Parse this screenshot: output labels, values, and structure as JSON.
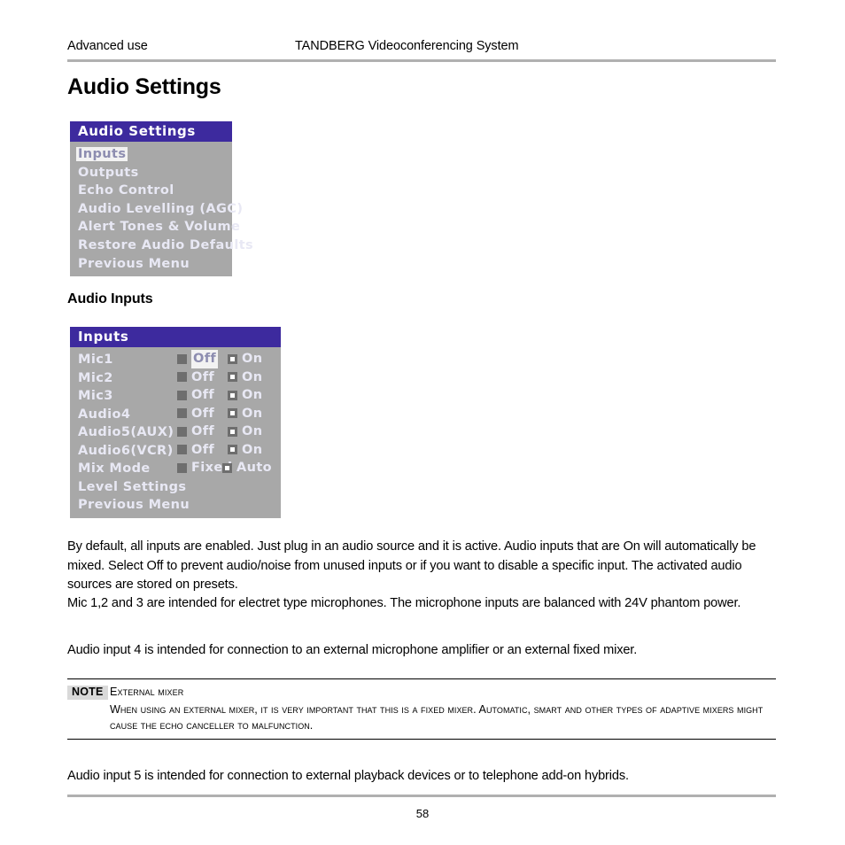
{
  "header": {
    "left": "Advanced use",
    "center": "TANDBERG Videoconferencing System"
  },
  "page_title": "Audio Settings",
  "sub_title": "Audio Inputs",
  "menu_audio_settings": {
    "title": "Audio Settings",
    "items": [
      {
        "label": "Inputs",
        "highlighted": true
      },
      {
        "label": "Outputs",
        "highlighted": false
      },
      {
        "label": "Echo Control",
        "highlighted": false
      },
      {
        "label": "Audio Levelling (AGC)",
        "highlighted": false
      },
      {
        "label": "Alert Tones & Volume",
        "highlighted": false
      },
      {
        "label": "Restore Audio Defaults",
        "highlighted": false
      },
      {
        "label": "Previous Menu",
        "highlighted": false
      }
    ]
  },
  "menu_inputs": {
    "title": "Inputs",
    "rows": [
      {
        "label": "Mic1",
        "off_label": "Off",
        "on_label": "On",
        "selected": "On",
        "highlighted_option": "Off"
      },
      {
        "label": "Mic2",
        "off_label": "Off",
        "on_label": "On",
        "selected": "On",
        "highlighted_option": ""
      },
      {
        "label": "Mic3",
        "off_label": "Off",
        "on_label": "On",
        "selected": "On",
        "highlighted_option": ""
      },
      {
        "label": "Audio4",
        "off_label": "Off",
        "on_label": "On",
        "selected": "On",
        "highlighted_option": ""
      },
      {
        "label": "Audio5(AUX)",
        "off_label": "Off",
        "on_label": "On",
        "selected": "On",
        "highlighted_option": ""
      },
      {
        "label": "Audio6(VCR)",
        "off_label": "Off",
        "on_label": "On",
        "selected": "On",
        "highlighted_option": ""
      },
      {
        "label": "Mix Mode",
        "off_label": "Fixed",
        "on_label": "Auto",
        "selected": "Auto",
        "highlighted_option": ""
      }
    ],
    "plain_items": [
      {
        "label": "Level Settings"
      },
      {
        "label": "Previous Menu"
      }
    ]
  },
  "paragraphs": {
    "p1": "By default, all inputs are enabled. Just plug in an audio source and it is active. Audio inputs that are On will automatically be mixed. Select Off to prevent audio/noise from unused inputs or if you want to disable a specific input. The activated audio sources are stored on presets.",
    "p2": "Mic 1,2 and 3 are intended for electret type microphones. The microphone inputs are balanced with 24V phantom power.",
    "p3": "Audio input 4 is intended for connection to an external microphone amplifier or an external fixed mixer.",
    "p4": "Audio input 5 is intended for connection to external playback devices or to telephone add-on hybrids."
  },
  "note": {
    "badge": "NOTE",
    "heading": "External mixer",
    "body": "When using an external mixer, it is very important that this is a fixed mixer. Automatic, smart and other types of adaptive mixers might cause the echo canceller to malfunction."
  },
  "footer": {
    "page_number": "58"
  },
  "colors": {
    "osd_title_bar": "#3d2a9e",
    "osd_body": "#a8a8a8",
    "osd_text": "#e8e8f4",
    "highlight_bg": "#f2f2f2",
    "highlight_text": "#8d8db0",
    "rule": "#b0b0b0",
    "note_badge_bg": "#d9d9d9"
  }
}
